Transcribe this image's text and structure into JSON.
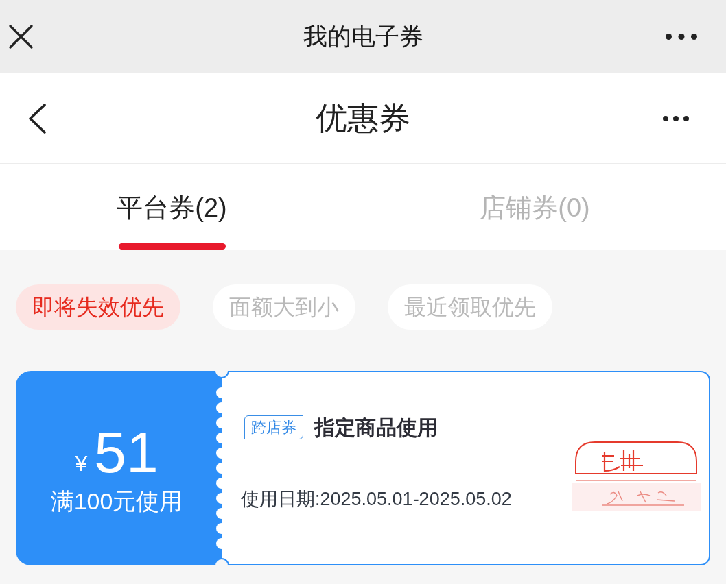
{
  "top_bar": {
    "title": "我的电子券"
  },
  "nav_bar": {
    "title": "优惠券"
  },
  "tabs": [
    {
      "label": "平台券(2)",
      "selected": true
    },
    {
      "label": "店铺券(0)",
      "selected": false
    }
  ],
  "sort_chips": [
    {
      "label": "即将失效优先",
      "selected": true
    },
    {
      "label": "面额大到小",
      "selected": false
    },
    {
      "label": "最近领取优先",
      "selected": false
    }
  ],
  "coupons": [
    {
      "currency": "¥",
      "amount": "51",
      "condition": "满100元使用",
      "tag": "跨店券",
      "title": "指定商品使用",
      "validity": "使用日期:2025.05.01-2025.05.02",
      "stamped": true
    }
  ]
}
